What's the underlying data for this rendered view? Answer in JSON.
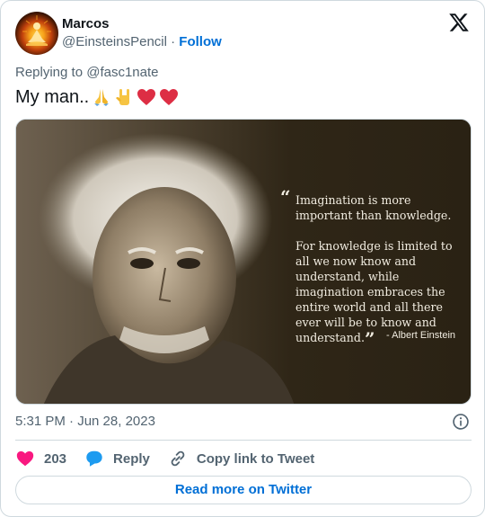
{
  "author": {
    "name": "Marcos",
    "handle": "@EinsteinsPencil",
    "separator": "·",
    "follow_label": "Follow"
  },
  "brand_icon": "x-logo-icon",
  "reply": {
    "prefix": "Replying to",
    "mention": "@fasc1nate"
  },
  "tweet": {
    "text": "My man..",
    "emojis": [
      "folded-hands-icon",
      "sign-of-horns-icon",
      "red-heart-icon",
      "red-heart-icon"
    ]
  },
  "media": {
    "quote_lines": [
      "Imagination is more important than knowledge.",
      "For knowledge is limited to all we now know and understand, while imagination embraces the entire world and all there ever will be to know and understand."
    ],
    "attribution": "- Albert Einstein"
  },
  "timestamp": "5:31 PM · Jun 28, 2023",
  "info_icon": "info-icon",
  "actions": {
    "like_count": "203",
    "reply_label": "Reply",
    "copy_label": "Copy link to Tweet"
  },
  "read_more_label": "Read more on Twitter",
  "colors": {
    "link": "#006fd6",
    "secondary": "#536471",
    "heart": "#f91880",
    "reply_bubble": "#1d9bf0",
    "border": "#cfd9de"
  }
}
